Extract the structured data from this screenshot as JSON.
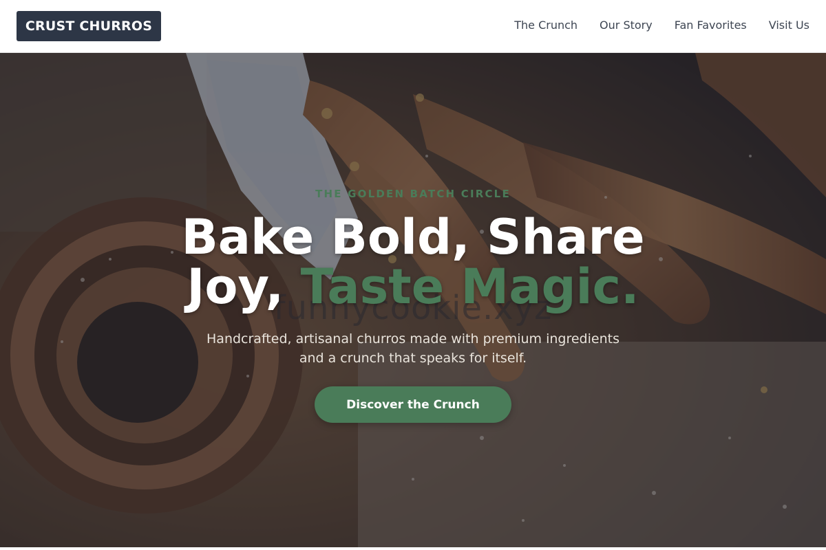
{
  "header": {
    "logo": "CRUST CHURROS",
    "nav": [
      {
        "label": "The Crunch"
      },
      {
        "label": "Our Story"
      },
      {
        "label": "Fan Favorites"
      },
      {
        "label": "Visit Us"
      }
    ]
  },
  "hero": {
    "eyebrow": "THE GOLDEN BATCH CIRCLE",
    "headline_line1": "Bake Bold, Share",
    "headline_line2_prefix": "Joy, ",
    "headline_line2_accent": "Taste Magic.",
    "watermark": "funnycookie.xyz",
    "subtext_line1": "Handcrafted, artisanal churros made with premium ingredients",
    "subtext_line2": "and a crunch that speaks for itself.",
    "cta_label": "Discover the Crunch",
    "background_image": "churros-on-board-photo"
  },
  "colors": {
    "brand_dark": "#2d3646",
    "accent_green": "#4a7c59",
    "overlay": "#1e222e"
  }
}
